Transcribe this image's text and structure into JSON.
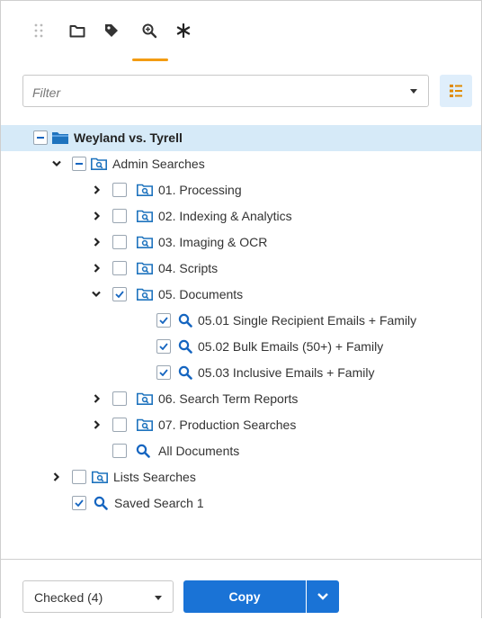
{
  "toolbar": {
    "icons": [
      "drag-handle-icon",
      "folder-icon",
      "tag-icon",
      "saved-search-icon",
      "asterisk-icon"
    ],
    "active_index": 3,
    "accent": "#f39c12"
  },
  "filter": {
    "placeholder": "Filter",
    "value": ""
  },
  "tree": {
    "root": "Weyland vs. Tyrell",
    "admin": "Admin Searches",
    "items": [
      "01. Processing",
      "02. Indexing & Analytics",
      "03. Imaging & OCR",
      "04. Scripts",
      "05. Documents",
      "05.01 Single Recipient Emails + Family",
      "05.02 Bulk Emails (50+) + Family",
      "05.03 Inclusive Emails + Family",
      "06. Search Term Reports",
      "07. Production Searches",
      "All Documents"
    ],
    "lists": "Lists Searches",
    "saved": "Saved Search 1"
  },
  "footer": {
    "select_value": "Checked (4)",
    "copy_label": "Copy"
  },
  "colors": {
    "primary": "#1a73d6",
    "selected_row": "#d6eaf8",
    "folder": "#1e73be"
  }
}
